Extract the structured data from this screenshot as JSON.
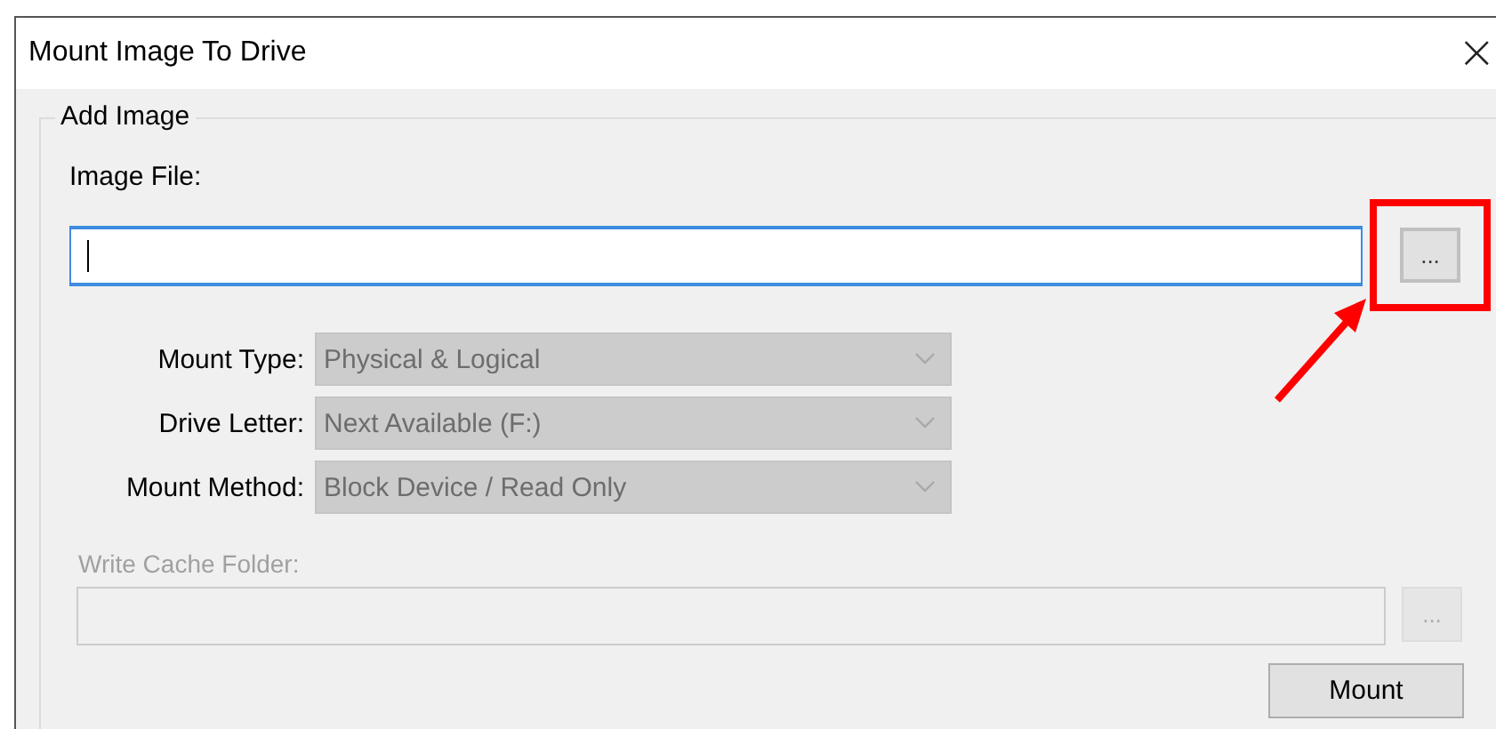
{
  "window": {
    "title": "Mount Image To Drive",
    "close": "×"
  },
  "group": {
    "title": "Add Image",
    "image_file": {
      "label": "Image File:",
      "focused": true,
      "browse": {
        "label": "...",
        "disabled": false,
        "highlighted": true
      }
    },
    "options": [
      {
        "label": "Mount Type:",
        "value": "Physical & Logical",
        "disabled": true
      },
      {
        "label": "Drive Letter:",
        "value": "Next Available (F:)",
        "disabled": true
      },
      {
        "label": "Mount Method:",
        "value": "Block Device / Read Only",
        "disabled": true
      }
    ],
    "write_cache": {
      "label": "Write Cache Folder:",
      "disabled": true,
      "browse": {
        "label": "...",
        "disabled": true
      }
    },
    "mount_button": "Mount"
  }
}
